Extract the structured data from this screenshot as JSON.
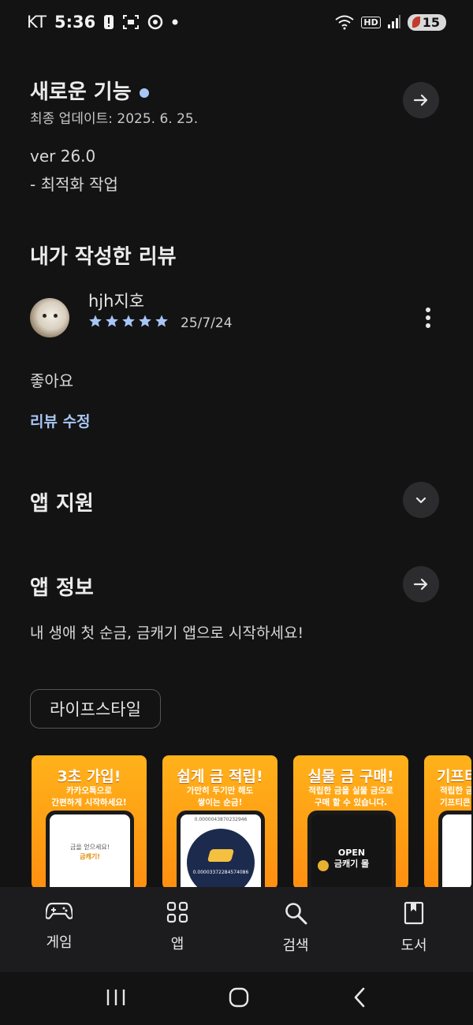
{
  "status_bar": {
    "carrier": "KT",
    "time": "5:36",
    "battery": "15",
    "network_badge": "HD",
    "icons": [
      "alert-icon",
      "screenshot-icon",
      "chrome-icon",
      "dot-icon",
      "wifi-icon",
      "hd-icon",
      "signal-icon",
      "battery-icon"
    ]
  },
  "whats_new": {
    "title": "새로운 기능",
    "updated": "최종 업데이트: 2025. 6. 25.",
    "version": "ver 26.0",
    "note": "- 최적화 작업"
  },
  "my_review": {
    "title": "내가 작성한 리뷰",
    "author": "hjh지호",
    "rating": 5,
    "date": "25/7/24",
    "body": "좋아요",
    "edit_label": "리뷰 수정"
  },
  "app_support": {
    "title": "앱 지원"
  },
  "app_info": {
    "title": "앱 정보",
    "description": "내 생애 첫 순금, 금캐기 앱으로 시작하세요!",
    "category": "라이프스타일"
  },
  "screenshots": [
    {
      "headline": "3초 가입!",
      "sub1": "카카오톡으로",
      "sub2": "간편하게 시작하세요!",
      "screen1": "금을 얻으세요!",
      "screen2": "금캐기!"
    },
    {
      "headline": "쉽게 금 적립!",
      "sub1": "가만히 두기만 해도",
      "sub2": "쌓이는 순금!",
      "screen1": "0.0000043870232946",
      "screen2": "0.00003372284574086"
    },
    {
      "headline": "실물 금 구매!",
      "sub1": "적립한 금을 실물 금으로",
      "sub2": "구매 할 수 있습니다.",
      "screen1": "OPEN",
      "screen2": "금캐기 몰"
    },
    {
      "headline": "기프티",
      "sub1": "적립한 금",
      "sub2": "기프티콘",
      "screen1": "",
      "screen2": ""
    }
  ],
  "bottom_nav": [
    {
      "label": "게임",
      "icon": "gamepad-icon"
    },
    {
      "label": "앱",
      "icon": "apps-grid-icon"
    },
    {
      "label": "검색",
      "icon": "search-icon"
    },
    {
      "label": "도서",
      "icon": "book-icon"
    }
  ],
  "colors": {
    "background": "#131313",
    "accent": "#a8c6f5",
    "button_bg": "#2c2c2e",
    "screenshot_orange": "#ff9f14"
  }
}
